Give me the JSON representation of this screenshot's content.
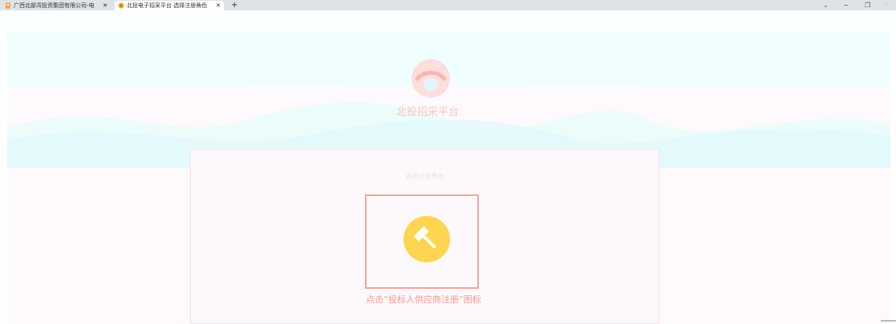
{
  "browser": {
    "tabs": [
      {
        "label": "广西北部湾投资集团有限公司-电",
        "icon": "document-icon",
        "active": false
      },
      {
        "label": "北投电子招采平台 选择注册角色",
        "icon": "building-icon",
        "active": true
      }
    ],
    "close_glyph": "✕",
    "new_tab_glyph": "+",
    "controls": {
      "dropdown": "⌄",
      "minimize": "−",
      "restore": "❐",
      "close": "✕"
    }
  },
  "page": {
    "brand": "北投招采平台",
    "panel_title": "选择注册角色",
    "role_card": {
      "icon": "gavel-icon"
    },
    "caption": "点击“投标人供应商注册”图标"
  },
  "colors": {
    "accent": "#f5a3a0",
    "caption": "#f79a8f",
    "role_icon": "#fdd551",
    "banner": "#f0fffd"
  }
}
